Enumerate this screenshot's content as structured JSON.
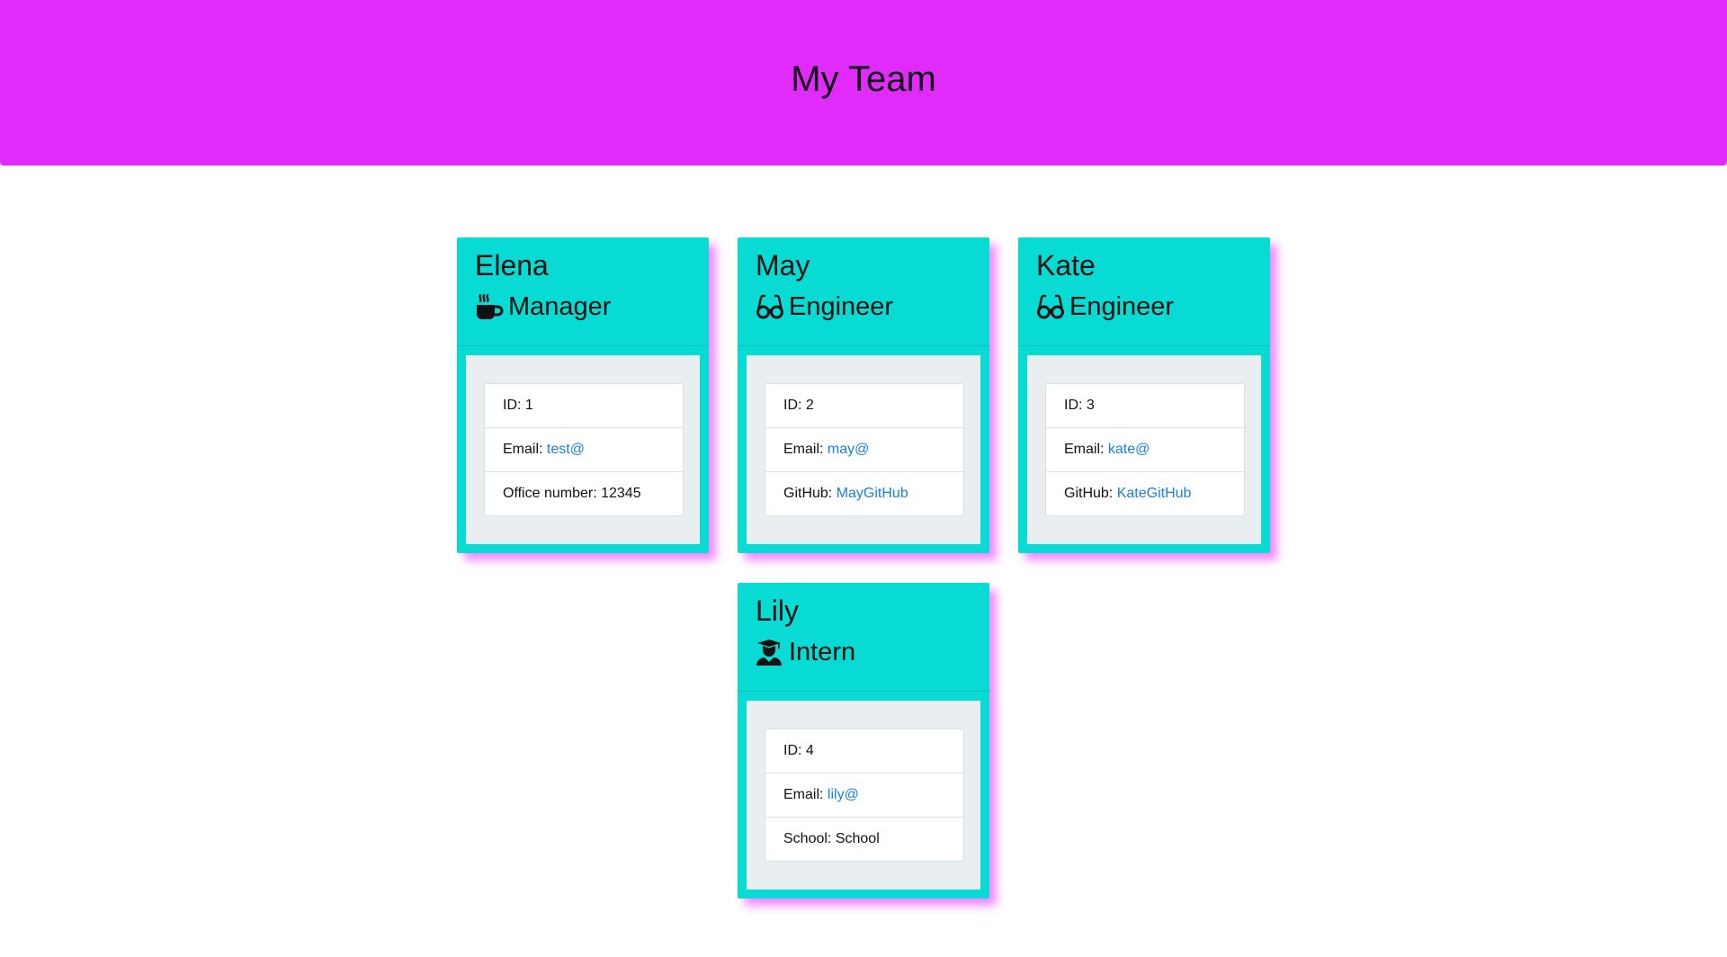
{
  "header": {
    "title": "My Team",
    "color": "#e12bfc"
  },
  "theme": {
    "card_color": "#07dbd3",
    "body_color": "#e9eef0",
    "link_color": "#1a7fe0"
  },
  "cards": [
    {
      "name": "Elena",
      "role": "Manager",
      "icon": "coffee-icon",
      "id_label": "ID:",
      "id_value": "1",
      "email_label": "Email:",
      "email": "test@",
      "extra_label": "Office number:",
      "extra_value": "12345"
    },
    {
      "name": "May",
      "role": "Engineer",
      "icon": "glasses-icon",
      "id_label": "ID:",
      "id_value": "2",
      "email_label": "Email:",
      "email": "may@",
      "extra_label": "GitHub:",
      "extra_value": "MayGitHub"
    },
    {
      "name": "Kate",
      "role": "Engineer",
      "icon": "glasses-icon",
      "id_label": "ID:",
      "id_value": "3",
      "email_label": "Email:",
      "email": "kate@",
      "extra_label": "GitHub:",
      "extra_value": "KateGitHub"
    },
    {
      "name": "Lily",
      "role": "Intern",
      "icon": "graduate-icon",
      "id_label": "ID:",
      "id_value": "4",
      "email_label": "Email:",
      "email": "lily@",
      "extra_label": "School:",
      "extra_value": "School"
    }
  ]
}
